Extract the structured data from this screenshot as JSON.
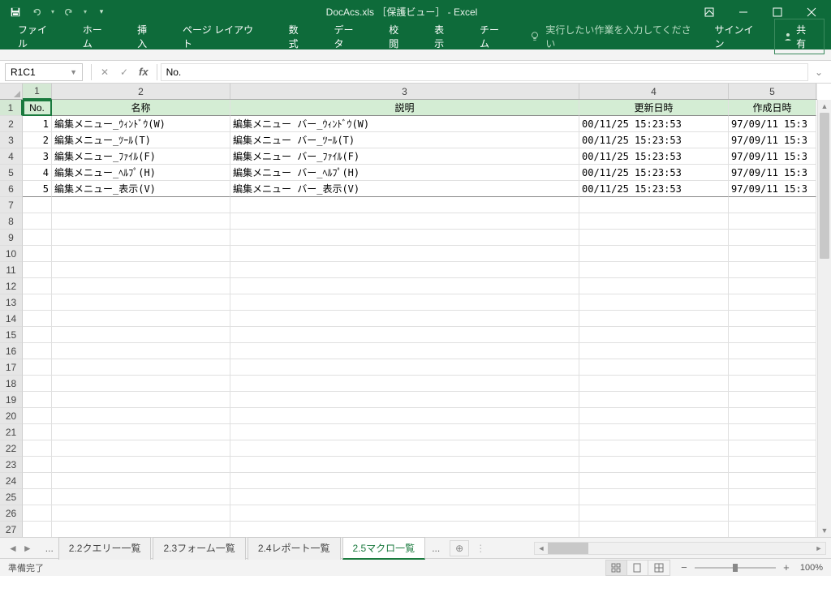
{
  "title": "DocAcs.xls ［保護ビュー］ - Excel",
  "qat": {
    "save": "保存",
    "undo": "元に戻す",
    "redo": "やり直し"
  },
  "ribbon": {
    "tabs": [
      "ファイル",
      "ホーム",
      "挿入",
      "ページ レイアウト",
      "数式",
      "データ",
      "校閲",
      "表示",
      "チーム"
    ],
    "tellme": "実行したい作業を入力してください",
    "signin": "サインイン",
    "share": "共有"
  },
  "namebox": "R1C1",
  "formula": "No.",
  "colHeaders": [
    "1",
    "2",
    "3",
    "4",
    "5"
  ],
  "rowHeaders": [
    "1",
    "2",
    "3",
    "4",
    "5",
    "6",
    "7",
    "8",
    "9",
    "10",
    "11",
    "12",
    "13",
    "14",
    "15",
    "16",
    "17",
    "18",
    "19",
    "20",
    "21",
    "22",
    "23",
    "24",
    "25",
    "26",
    "27"
  ],
  "headerRow": [
    "No.",
    "名称",
    "説明",
    "更新日時",
    "作成日時"
  ],
  "rows": [
    {
      "no": "1",
      "name": "編集メニュー_ｳｨﾝﾄﾞｳ(W)",
      "desc": "編集メニュー バー_ｳｨﾝﾄﾞｳ(W)",
      "upd": "00/11/25 15:23:53",
      "crt": "97/09/11 15:3"
    },
    {
      "no": "2",
      "name": "編集メニュー_ﾂｰﾙ(T)",
      "desc": "編集メニュー バー_ﾂｰﾙ(T)",
      "upd": "00/11/25 15:23:53",
      "crt": "97/09/11 15:3"
    },
    {
      "no": "3",
      "name": "編集メニュー_ﾌｧｲﾙ(F)",
      "desc": "編集メニュー バー_ﾌｧｲﾙ(F)",
      "upd": "00/11/25 15:23:53",
      "crt": "97/09/11 15:3"
    },
    {
      "no": "4",
      "name": "編集メニュー_ﾍﾙﾌﾟ(H)",
      "desc": "編集メニュー バー_ﾍﾙﾌﾟ(H)",
      "upd": "00/11/25 15:23:53",
      "crt": "97/09/11 15:3"
    },
    {
      "no": "5",
      "name": "編集メニュー_表示(V)",
      "desc": "編集メニュー バー_表示(V)",
      "upd": "00/11/25 15:23:53",
      "crt": "97/09/11 15:3"
    }
  ],
  "sheets": {
    "ellipsis": "...",
    "tabs": [
      "2.2クエリー一覧",
      "2.3フォーム一覧",
      "2.4レポート一覧",
      "2.5マクロ一覧"
    ],
    "active": "2.5マクロ一覧",
    "trailing": "..."
  },
  "status": {
    "ready": "準備完了",
    "zoom": "100%"
  }
}
